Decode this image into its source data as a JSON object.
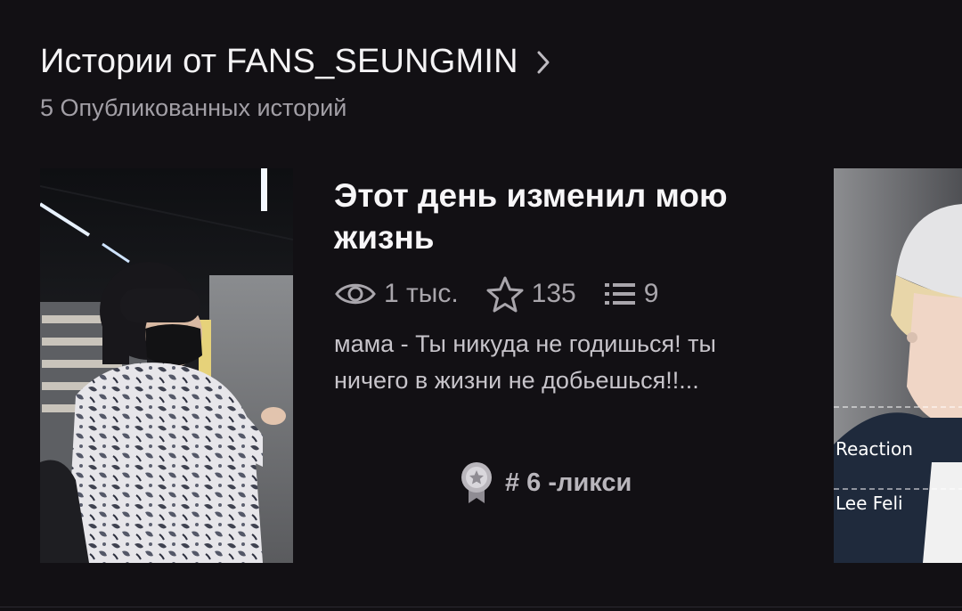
{
  "header": {
    "title": "Истории от FANS_SEUNGMIN",
    "subtitle": "5 Опубликованных историй"
  },
  "story": {
    "title": "Этот день изменил мою жизнь",
    "stats": {
      "views": "1 тыс.",
      "votes": "135",
      "parts": "9"
    },
    "description": "мама - Ты никуда не годишься! ты ничего в жизни не добьешься!!...",
    "rank": "# 6 -ликси"
  },
  "next_story": {
    "cover_text_1": "Reaction",
    "cover_text_2": "Lee Feli"
  },
  "icons": {
    "chevron": "chevron-right-icon",
    "views": "eye-icon",
    "votes": "star-icon",
    "parts": "list-icon",
    "rank": "ribbon-badge-icon"
  },
  "colors": {
    "background": "#121014",
    "title": "#f4f3f5",
    "muted": "#a29fa6"
  }
}
